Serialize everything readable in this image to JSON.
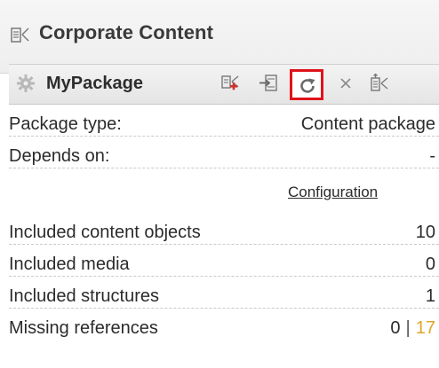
{
  "panel": {
    "title": "Corporate Content",
    "title_icon": "content-tree-icon"
  },
  "package": {
    "name": "MyPackage",
    "icon": "gear-icon",
    "toolbar": [
      {
        "icon": "add-content-icon"
      },
      {
        "icon": "import-icon"
      },
      {
        "icon": "refresh-icon",
        "highlighted": true,
        "highlight_color": "#e0121b"
      },
      {
        "icon": "close-icon"
      },
      {
        "icon": "export-icon"
      }
    ]
  },
  "properties": {
    "package_type_label": "Package type:",
    "package_type_value": "Content package",
    "depends_on_label": "Depends on:",
    "depends_on_value": "-",
    "configuration_link": "Configuration",
    "included_content_label": "Included content objects",
    "included_content_value": "10",
    "included_media_label": "Included media",
    "included_media_value": "0",
    "included_structures_label": "Included structures",
    "included_structures_value": "1",
    "missing_references_label": "Missing references",
    "missing_references_value": "0",
    "missing_references_separator": "|",
    "missing_references_count": "17",
    "missing_references_color": "#e0a52a"
  }
}
